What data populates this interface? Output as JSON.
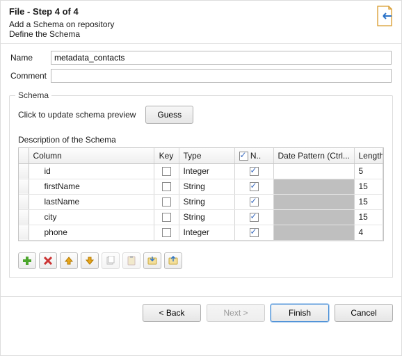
{
  "header": {
    "title": "File - Step 4 of 4",
    "sub1": "Add a Schema on repository",
    "sub2": "Define the Schema"
  },
  "form": {
    "name_label": "Name",
    "name_value": "metadata_contacts",
    "comment_label": "Comment",
    "comment_value": ""
  },
  "schema": {
    "group_title": "Schema",
    "preview_hint": "Click to update schema preview",
    "guess_label": "Guess",
    "desc_label": "Description of the Schema",
    "columns": {
      "col": "Column",
      "key": "Key",
      "type": "Type",
      "n": "N..",
      "date": "Date Pattern (Ctrl...",
      "len": "Length"
    },
    "rows": [
      {
        "col": "id",
        "key": false,
        "type": "Integer",
        "n": true,
        "date": "",
        "date_gray": false,
        "len": "5"
      },
      {
        "col": "firstName",
        "key": false,
        "type": "String",
        "n": true,
        "date": "",
        "date_gray": true,
        "len": "15"
      },
      {
        "col": "lastName",
        "key": false,
        "type": "String",
        "n": true,
        "date": "",
        "date_gray": true,
        "len": "15"
      },
      {
        "col": "city",
        "key": false,
        "type": "String",
        "n": true,
        "date": "",
        "date_gray": true,
        "len": "15"
      },
      {
        "col": "phone",
        "key": false,
        "type": "Integer",
        "n": true,
        "date": "",
        "date_gray": true,
        "len": "4"
      }
    ]
  },
  "toolbar": {
    "add": "add-icon",
    "remove": "remove-icon",
    "up": "arrow-up-icon",
    "down": "arrow-down-icon",
    "copy": "copy-icon",
    "paste": "paste-icon",
    "import": "import-icon",
    "export": "export-icon"
  },
  "footer": {
    "back": "< Back",
    "next": "Next >",
    "finish": "Finish",
    "cancel": "Cancel"
  }
}
